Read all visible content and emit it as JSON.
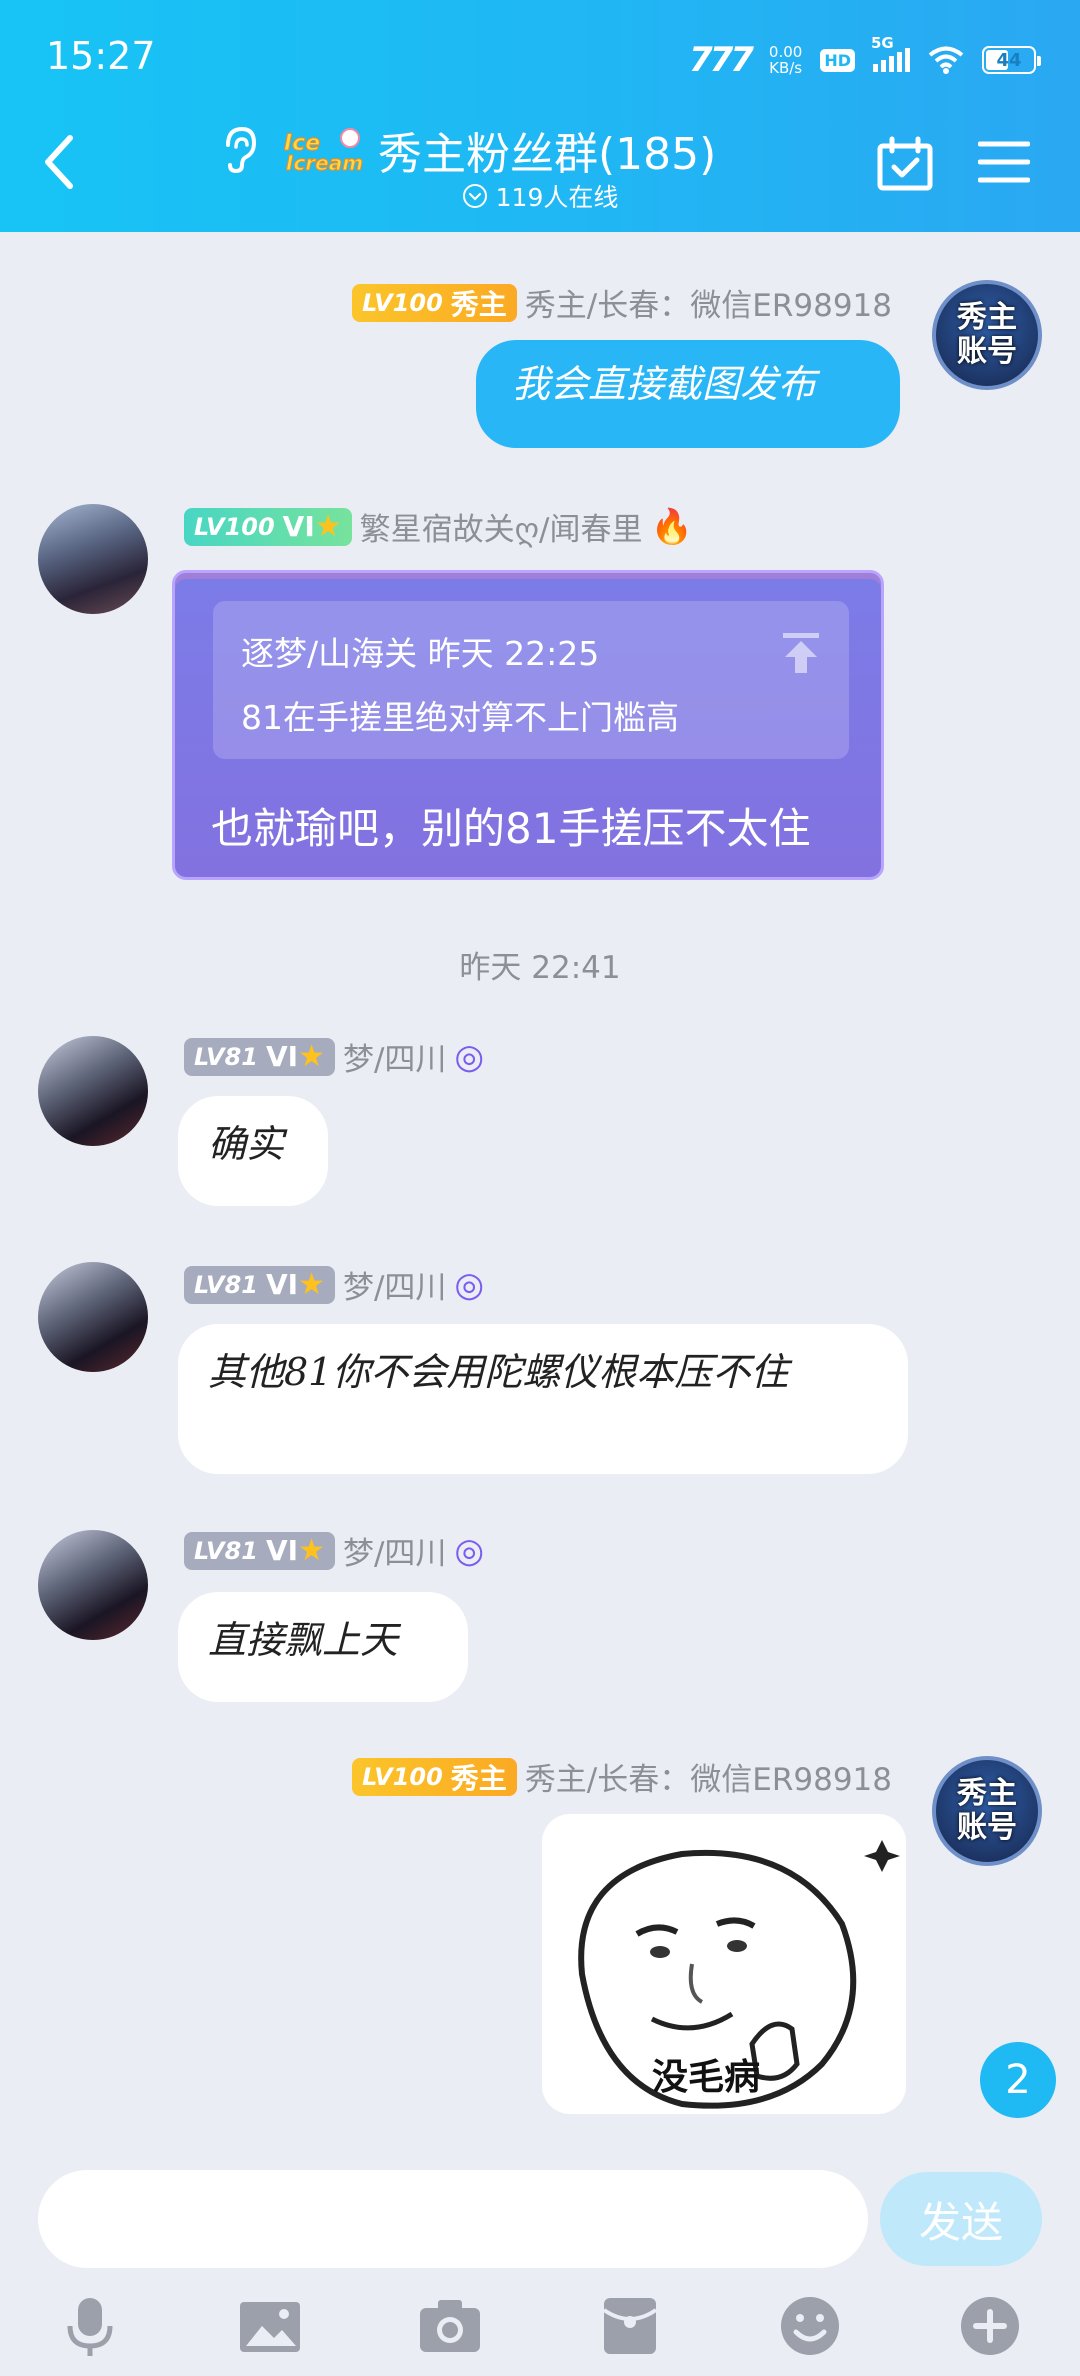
{
  "status_bar": {
    "time": "15:27",
    "carrier": "777",
    "speed_value": "0.00",
    "speed_unit": "KB/s",
    "hd": "HD",
    "network": "5G",
    "battery": "44"
  },
  "header": {
    "title": "秀主粉丝群(185)",
    "online_count": "119人在线",
    "logo_text": "ice cream"
  },
  "messages": [
    {
      "sender_level": "LV100",
      "sender_title": "秀主",
      "sender_name": "秀主/长春：微信ER98918",
      "avatar_text_1": "秀主",
      "avatar_text_2": "账号",
      "text": "我会直接截图发布"
    },
    {
      "sender_level": "LV100",
      "sender_title": "VI",
      "sender_name": "繁星宿故关ღ/闻春里",
      "quote_header": "逐梦/山海关 昨天 22:25",
      "quote_text": "81在手搓里绝对算不上门槛高",
      "text": "也就瑜吧，别的81手搓压不太住"
    },
    {
      "sender_level": "LV81",
      "sender_title": "VI",
      "sender_name": "梦/四川",
      "text": "确实"
    },
    {
      "sender_level": "LV81",
      "sender_title": "VI",
      "sender_name": "梦/四川",
      "text": "其他81你不会用陀螺仪根本压不住"
    },
    {
      "sender_level": "LV81",
      "sender_title": "VI",
      "sender_name": "梦/四川",
      "text": "直接飘上天"
    },
    {
      "sender_level": "LV100",
      "sender_title": "秀主",
      "sender_name": "秀主/长春：微信ER98918",
      "avatar_text_1": "秀主",
      "avatar_text_2": "账号",
      "sticker_caption": "没毛病"
    }
  ],
  "time_separator": "昨天 22:41",
  "unread_count": "2",
  "input": {
    "placeholder": "",
    "send_label": "发送"
  },
  "toolbar_icons": [
    "microphone-icon",
    "image-icon",
    "camera-icon",
    "red-packet-icon",
    "emoji-icon",
    "plus-icon"
  ],
  "colors": {
    "header_gradient_start": "#17c4f5",
    "header_gradient_end": "#2aa8f2",
    "bubble_blue": "#29b6f6",
    "background": "#eaedf4",
    "badge_gold": "#fbb824",
    "send_button": "#bfe9fb"
  }
}
